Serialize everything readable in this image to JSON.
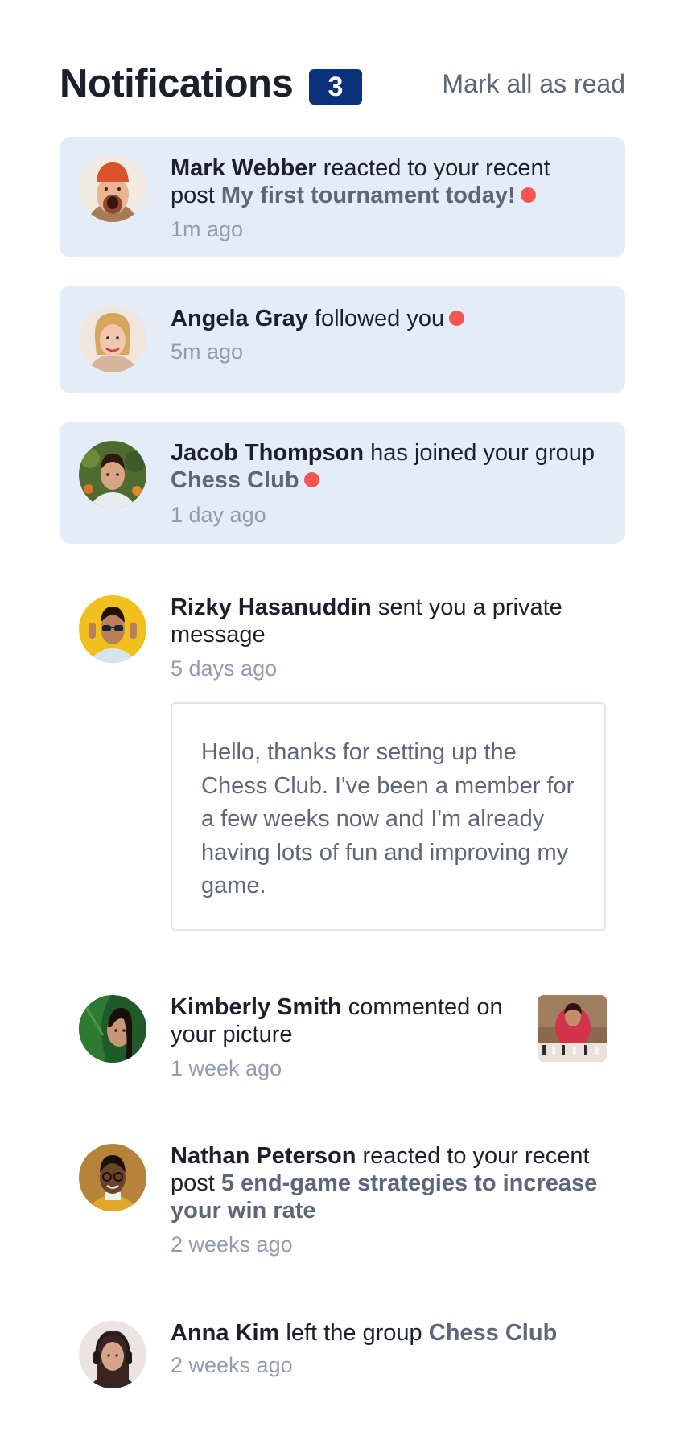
{
  "header": {
    "title": "Notifications",
    "unread_count": "3",
    "mark_all_label": "Mark all as read"
  },
  "colors": {
    "badge": "#0a327b",
    "unread_bg": "#e3ecf7",
    "unread_dot": "#f65552",
    "name_text": "#1c202b",
    "secondary_text": "#5e6778",
    "time_text": "#939cad"
  },
  "notifications": [
    {
      "name": "Mark Webber",
      "action": " reacted to your recent post ",
      "target": "My first tournament today!",
      "time": "1m ago",
      "unread": true,
      "avatar": "avatar-mark-webber"
    },
    {
      "name": "Angela Gray",
      "action": " followed you",
      "target": "",
      "time": "5m ago",
      "unread": true,
      "avatar": "avatar-angela-gray"
    },
    {
      "name": "Jacob Thompson",
      "action": " has joined your group ",
      "target": "Chess Club",
      "time": "1 day ago",
      "unread": true,
      "avatar": "avatar-jacob-thompson"
    },
    {
      "name": "Rizky Hasanuddin",
      "action": " sent you a private message",
      "target": "",
      "time": "5 days ago",
      "unread": false,
      "avatar": "avatar-rizky-hasanuddin",
      "message": "Hello, thanks for setting up the Chess Club. I've been a member for a few weeks now and I'm already having lots of fun and improving my game."
    },
    {
      "name": "Kimberly Smith",
      "action": " commented on your picture",
      "target": "",
      "time": "1 week ago",
      "unread": false,
      "avatar": "avatar-kimberly-smith",
      "picture": "chess-picture"
    },
    {
      "name": "Nathan Peterson",
      "action": " reacted to your recent post ",
      "target": "5 end-game strategies to increase your win rate",
      "time": "2 weeks ago",
      "unread": false,
      "avatar": "avatar-nathan-peterson"
    },
    {
      "name": "Anna Kim",
      "action": " left the group ",
      "target": "Chess Club",
      "time": "2 weeks ago",
      "unread": false,
      "avatar": "avatar-anna-kim"
    }
  ]
}
